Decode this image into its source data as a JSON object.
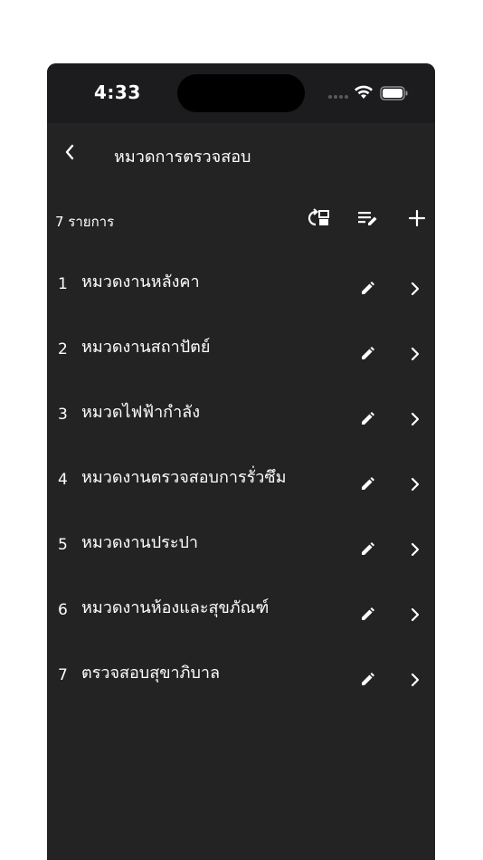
{
  "status_bar": {
    "time": "4:33"
  },
  "nav": {
    "title": "หมวดการตรวจสอบ",
    "back_icon": "chevron-left-icon"
  },
  "toolbar": {
    "count_label": "7 รายการ",
    "icons": [
      "reorder-swap-icon",
      "edit-list-icon",
      "add-icon"
    ]
  },
  "items": [
    {
      "num": "1",
      "title": "หมวดงานหลังคา"
    },
    {
      "num": "2",
      "title": "หมวดงานสถาปัตย์"
    },
    {
      "num": "3",
      "title": "หมวดไฟฟ้ากำลัง"
    },
    {
      "num": "4",
      "title": "หมวดงานตรวจสอบการรั่วซึม"
    },
    {
      "num": "5",
      "title": "หมวดงานประปา"
    },
    {
      "num": "6",
      "title": "หมวดงานห้องและสุขภัณฑ์"
    },
    {
      "num": "7",
      "title": "ตรวจสอบสุขาภิบาล"
    }
  ],
  "colors": {
    "background": "#232323",
    "status_bar": "#1c1c1e",
    "text": "#ffffff"
  }
}
